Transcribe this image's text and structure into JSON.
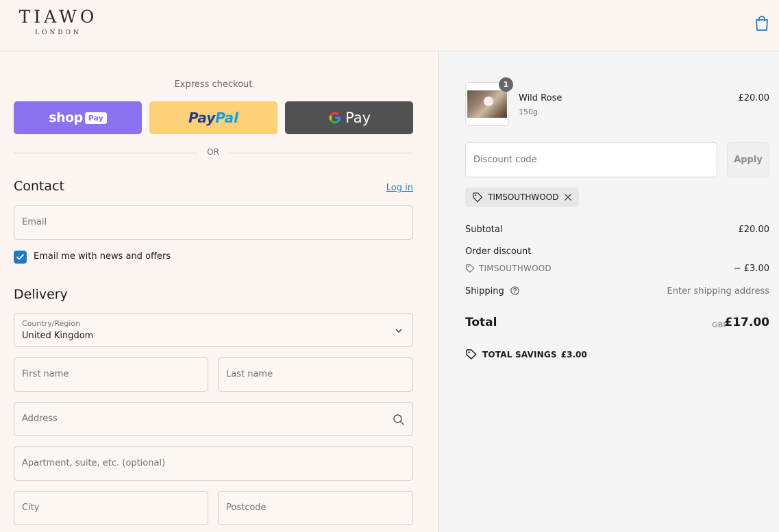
{
  "header": {
    "logo_main": "TIAWO",
    "logo_sub": "LONDON",
    "cart_icon": "shopping-bag-icon"
  },
  "express": {
    "title": "Express checkout",
    "shop_pay": {
      "label": "shop",
      "badge": "Pay",
      "color": "#8b73f0"
    },
    "paypal": {
      "part1": "Pay",
      "part2": "Pal",
      "color": "#fdd07a"
    },
    "gpay": {
      "g": "G",
      "label": "Pay",
      "color": "#515151"
    },
    "divider": "OR"
  },
  "contact": {
    "title": "Contact",
    "login_link": "Log in",
    "email_placeholder": "Email",
    "newsletter_label": "Email me with news and offers",
    "newsletter_checked": true
  },
  "delivery": {
    "title": "Delivery",
    "country_label": "Country/Region",
    "country_value": "United Kingdom",
    "first_name_placeholder": "First name",
    "last_name_placeholder": "Last name",
    "address_placeholder": "Address",
    "apartment_placeholder": "Apartment, suite, etc. (optional)",
    "city_placeholder": "City",
    "postcode_placeholder": "Postcode"
  },
  "summary": {
    "product": {
      "quantity": "1",
      "name": "Wild Rose",
      "variant": "150g",
      "price": "£20.00"
    },
    "discount_placeholder": "Discount code",
    "apply_label": "Apply",
    "applied_code": "TIMSOUTHWOOD",
    "subtotal_label": "Subtotal",
    "subtotal_value": "£20.00",
    "order_discount_label": "Order discount",
    "order_discount_code": "TIMSOUTHWOOD",
    "order_discount_value": "− £3.00",
    "shipping_label": "Shipping",
    "shipping_value": "Enter shipping address",
    "total_label": "Total",
    "total_currency": "GBP",
    "total_value": "£17.00",
    "savings_label": "TOTAL SAVINGS",
    "savings_value": "£3.00"
  },
  "colors": {
    "accent": "#1f7ac5",
    "page_bg": "#fcf5f1",
    "summary_bg": "#f5f5f5"
  }
}
